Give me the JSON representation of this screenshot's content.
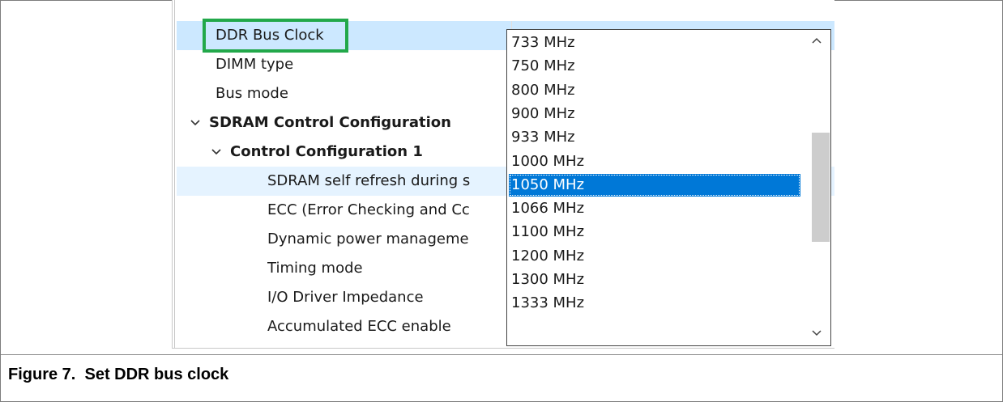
{
  "properties": {
    "rows": [
      {
        "label": "DDR Bus Clock",
        "value": "1050 MHz"
      },
      {
        "label": "DIMM type"
      },
      {
        "label": "Bus mode"
      },
      {
        "label": "SDRAM Control Configuration"
      },
      {
        "label": "Control Configuration 1"
      },
      {
        "label": "SDRAM self refresh during s"
      },
      {
        "label": "ECC (Error Checking and Cc"
      },
      {
        "label": "Dynamic power manageme"
      },
      {
        "label": "Timing mode"
      },
      {
        "label": "I/O Driver Impedance"
      },
      {
        "label": "Accumulated ECC enable"
      }
    ]
  },
  "dropdown": {
    "options": [
      "733 MHz",
      "750 MHz",
      "800 MHz",
      "900 MHz",
      "933 MHz",
      "1000 MHz",
      "1050 MHz",
      "1066 MHz",
      "1100 MHz",
      "1200 MHz",
      "1300 MHz",
      "1333 MHz"
    ],
    "selected_index": 6,
    "scroll_position": 0.5
  },
  "icons": {
    "combo_arrow": "chevron-down-icon",
    "expand": "chevron-down-icon",
    "scroll_up": "chevron-up-icon",
    "scroll_down": "chevron-down-icon"
  },
  "colors": {
    "highlight_border": "#22a84a",
    "selected_option": "#0078d7",
    "selected_row": "#cce8ff"
  },
  "caption": {
    "label": "Figure 7.",
    "text": "Set DDR bus clock"
  }
}
